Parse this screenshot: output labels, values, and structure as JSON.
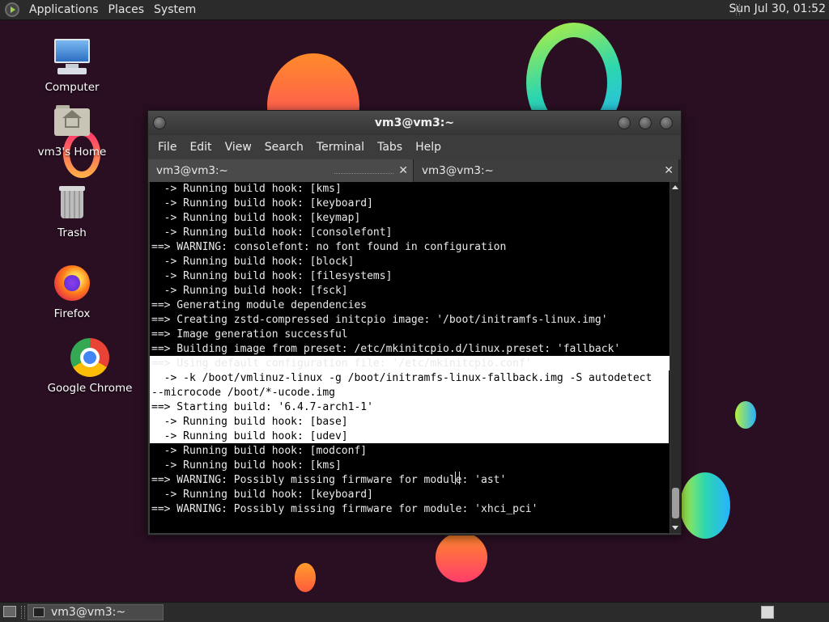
{
  "top_panel": {
    "menus": [
      "Applications",
      "Places",
      "System"
    ],
    "clock": "Sun Jul 30, 01:52"
  },
  "desktop_icons": {
    "computer": "Computer",
    "home": "vm3's Home",
    "trash": "Trash",
    "firefox": "Firefox",
    "chrome": "Google Chrome"
  },
  "window": {
    "title": "vm3@vm3:~",
    "menu": [
      "File",
      "Edit",
      "View",
      "Search",
      "Terminal",
      "Tabs",
      "Help"
    ],
    "tabs": [
      {
        "label": "vm3@vm3:~",
        "active": true
      },
      {
        "label": "vm3@vm3:~",
        "active": false
      }
    ]
  },
  "terminal": {
    "lines": [
      "  -> Running build hook: [kms]",
      "  -> Running build hook: [keyboard]",
      "  -> Running build hook: [keymap]",
      "  -> Running build hook: [consolefont]",
      "==> WARNING: consolefont: no font found in configuration",
      "  -> Running build hook: [block]",
      "  -> Running build hook: [filesystems]",
      "  -> Running build hook: [fsck]",
      "==> Generating module dependencies",
      "==> Creating zstd-compressed initcpio image: '/boot/initramfs-linux.img'",
      "==> Image generation successful",
      "==> Building image from preset: /etc/mkinitcpio.d/linux.preset: 'fallback'",
      "==> Using default configuration file: '/etc/mkinitcpio.conf'",
      "  -> -k /boot/vmlinuz-linux -g /boot/initramfs-linux-fallback.img -S autodetect",
      "--microcode /boot/*-ucode.img",
      "==> Starting build: '6.4.7-arch1-1'",
      "  -> Running build hook: [base]",
      "  -> Running build hook: [udev]",
      "  -> Running build hook: [modconf]",
      "  -> Running build hook: [kms]",
      "==> WARNING: Possibly missing firmware for module: 'ast'",
      "  -> Running build hook: [keyboard]",
      "==> WARNING: Possibly missing firmware for module: 'xhci_pci'"
    ]
  },
  "taskbar": {
    "task_label": "vm3@vm3:~"
  },
  "colors": {
    "desktop_bg": "#2a0f22",
    "terminal_bg": "#000000",
    "terminal_fg": "#e9e9e9",
    "selection_bg": "#ffffff"
  }
}
